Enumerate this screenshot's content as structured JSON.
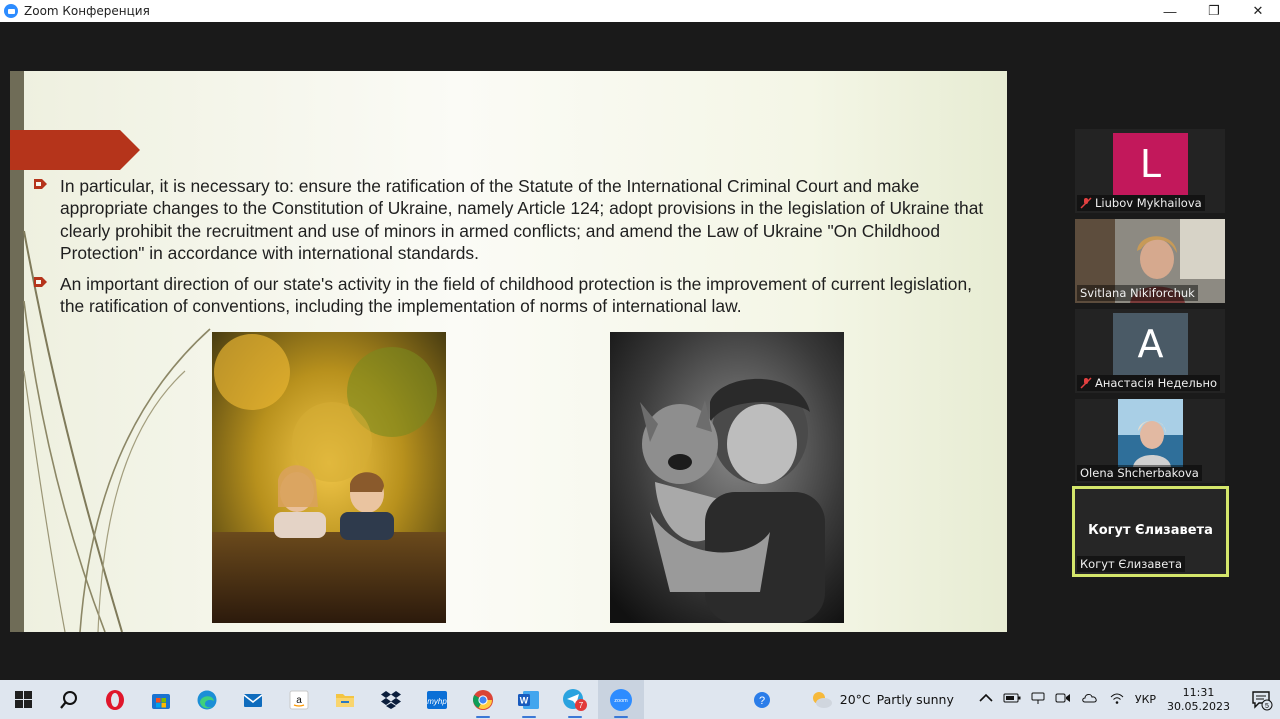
{
  "window": {
    "title": "Zoom Конференция",
    "minimize_glyph": "—",
    "maximize_glyph": "❐",
    "close_glyph": "✕"
  },
  "slide": {
    "bullets": [
      "In particular, it is necessary to: ensure the ratification of the Statute of the International Criminal Court and make appropriate changes to the Constitution of Ukraine, namely Article 124; adopt provisions in the legislation of Ukraine that clearly prohibit the recruitment and use of minors in armed conflicts; and amend the Law of Ukraine \"On Childhood Protection\" in accordance with international standards.",
      "An important direction of our state's activity in the field of childhood protection is the improvement of current legislation, the ratification of conventions, including the implementation of norms of international law."
    ],
    "colors": {
      "banner": "#b5341b",
      "bullet_marker": "#b5341b",
      "left_bar": "#6f6c57"
    }
  },
  "participants": [
    {
      "name": "Liubov Mykhailova",
      "avatar": "L",
      "avatar_color": "#c2185b",
      "muted": true
    },
    {
      "name": "Svitlana Nikiforchuk",
      "muted": false
    },
    {
      "name": "Анастасія Недельно",
      "avatar": "A",
      "avatar_color": "#4a5a66",
      "muted": true
    },
    {
      "name": "Olena Shcherbakova",
      "muted": false
    },
    {
      "name": "Когут Єлизавета",
      "center_label": "Когут Єлизавета",
      "active_speaker": true
    }
  ],
  "taskbar": {
    "apps": [
      "windows-start",
      "search",
      "opera",
      "microsoft-store",
      "edge",
      "mail",
      "amazon",
      "file-explorer",
      "dropbox",
      "myhp",
      "chrome",
      "word",
      "telegram",
      "zoom"
    ],
    "telegram_badge": "7",
    "weather": {
      "temp": "20°C",
      "condition": "Partly sunny"
    },
    "language": "УКР",
    "time": "11:31",
    "date": "30.05.2023",
    "notification_count": "5"
  }
}
